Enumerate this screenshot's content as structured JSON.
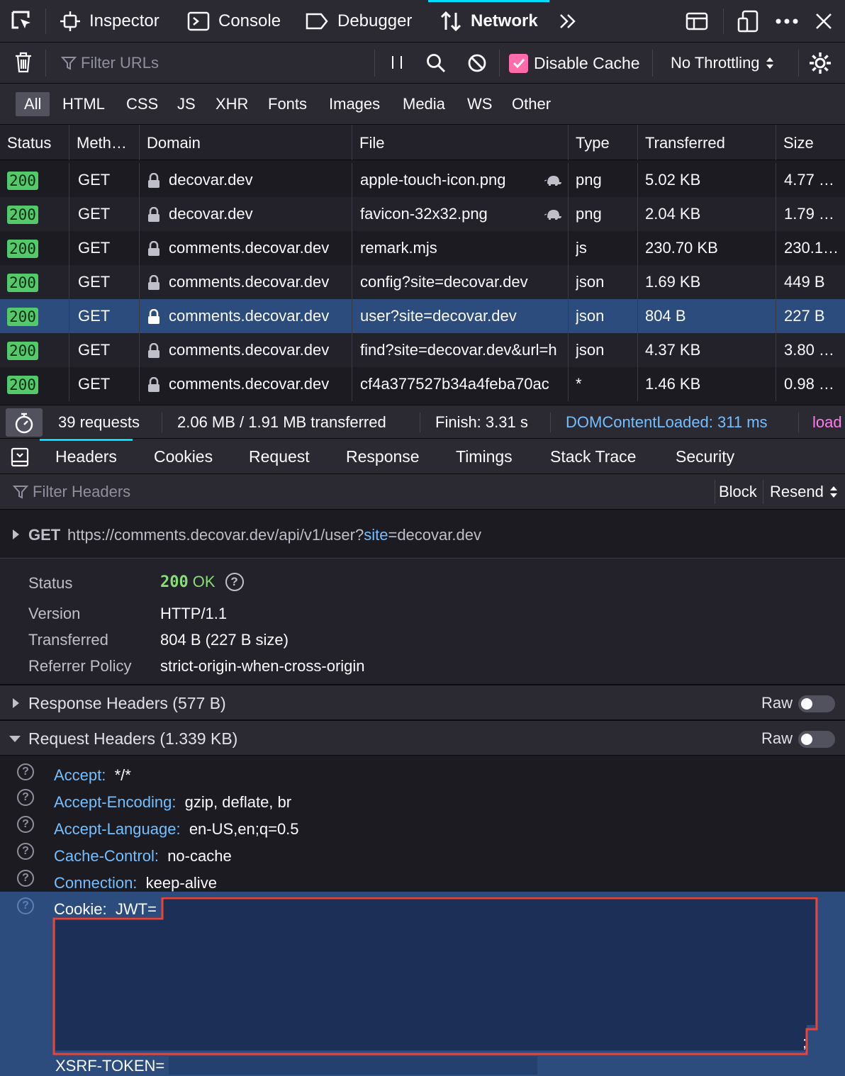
{
  "toolbar": {
    "tools": [
      {
        "label": "Inspector",
        "icon": "inspector-icon"
      },
      {
        "label": "Console",
        "icon": "console-icon"
      },
      {
        "label": "Debugger",
        "icon": "debugger-icon"
      },
      {
        "label": "Network",
        "icon": "network-icon",
        "active": true
      }
    ],
    "accent": "#00ddff"
  },
  "filterbar": {
    "filter_placeholder": "Filter URLs",
    "disable_cache_label": "Disable Cache",
    "disable_cache_checked": true,
    "throttling": "No Throttling"
  },
  "type_tabs": [
    "All",
    "HTML",
    "CSS",
    "JS",
    "XHR",
    "Fonts",
    "Images",
    "Media",
    "WS",
    "Other"
  ],
  "table": {
    "columns": [
      "Status",
      "Meth…",
      "Domain",
      "File",
      "Type",
      "Transferred",
      "Size"
    ],
    "rows": [
      {
        "status": "200",
        "method": "GET",
        "domain": "decovar.dev",
        "file": "apple-touch-icon.png",
        "type": "png",
        "transferred": "5.02 KB",
        "size": "4.77 …",
        "throttled": true
      },
      {
        "status": "200",
        "method": "GET",
        "domain": "decovar.dev",
        "file": "favicon-32x32.png",
        "type": "png",
        "transferred": "2.04 KB",
        "size": "1.79 …",
        "throttled": true
      },
      {
        "status": "200",
        "method": "GET",
        "domain": "comments.decovar.dev",
        "file": "remark.mjs",
        "type": "js",
        "transferred": "230.70 KB",
        "size": "230.1…"
      },
      {
        "status": "200",
        "method": "GET",
        "domain": "comments.decovar.dev",
        "file": "config?site=decovar.dev",
        "type": "json",
        "transferred": "1.69 KB",
        "size": "449 B"
      },
      {
        "status": "200",
        "method": "GET",
        "domain": "comments.decovar.dev",
        "file": "user?site=decovar.dev",
        "type": "json",
        "transferred": "804 B",
        "size": "227 B",
        "selected": true
      },
      {
        "status": "200",
        "method": "GET",
        "domain": "comments.decovar.dev",
        "file": "find?site=decovar.dev&url=h",
        "type": "json",
        "transferred": "4.37 KB",
        "size": "3.80 …"
      },
      {
        "status": "200",
        "method": "GET",
        "domain": "comments.decovar.dev",
        "file": "cf4a377527b34a4feba70ac",
        "type": "*",
        "transferred": "1.46 KB",
        "size": "0.98 …"
      }
    ]
  },
  "summary": {
    "requests": "39 requests",
    "transferred": "2.06 MB / 1.91 MB transferred",
    "finish": "Finish: 3.31 s",
    "dom_content_loaded": "DOMContentLoaded: 311 ms",
    "load": "load"
  },
  "detail_tabs": [
    "Headers",
    "Cookies",
    "Request",
    "Response",
    "Timings",
    "Stack Trace",
    "Security"
  ],
  "headers_panel": {
    "filter_placeholder": "Filter Headers",
    "block_label": "Block",
    "resend_label": "Resend",
    "request_method": "GET",
    "request_url_prefix": "https://comments.decovar.dev/api/v1/user?",
    "request_url_param": "site",
    "request_url_suffix": "=decovar.dev",
    "summary": [
      {
        "key": "Status",
        "value": "OK",
        "code": "200"
      },
      {
        "key": "Version",
        "value": "HTTP/1.1"
      },
      {
        "key": "Transferred",
        "value": "804 B (227 B size)"
      },
      {
        "key": "Referrer Policy",
        "value": "strict-origin-when-cross-origin"
      }
    ],
    "response_headers_title": "Response Headers (577 B)",
    "request_headers_title": "Request Headers (1.339 KB)",
    "raw_label": "Raw",
    "request_headers": [
      {
        "name": "Accept:",
        "value": "*/*"
      },
      {
        "name": "Accept-Encoding:",
        "value": "gzip, deflate, br"
      },
      {
        "name": "Accept-Language:",
        "value": "en-US,en;q=0.5"
      },
      {
        "name": "Cache-Control:",
        "value": "no-cache"
      },
      {
        "name": "Connection:",
        "value": "keep-alive"
      }
    ],
    "cookie_header": {
      "name": "Cookie:",
      "value_start": "JWT=",
      "semicolon": ";",
      "xsrf": "XSRF-TOKEN="
    }
  }
}
